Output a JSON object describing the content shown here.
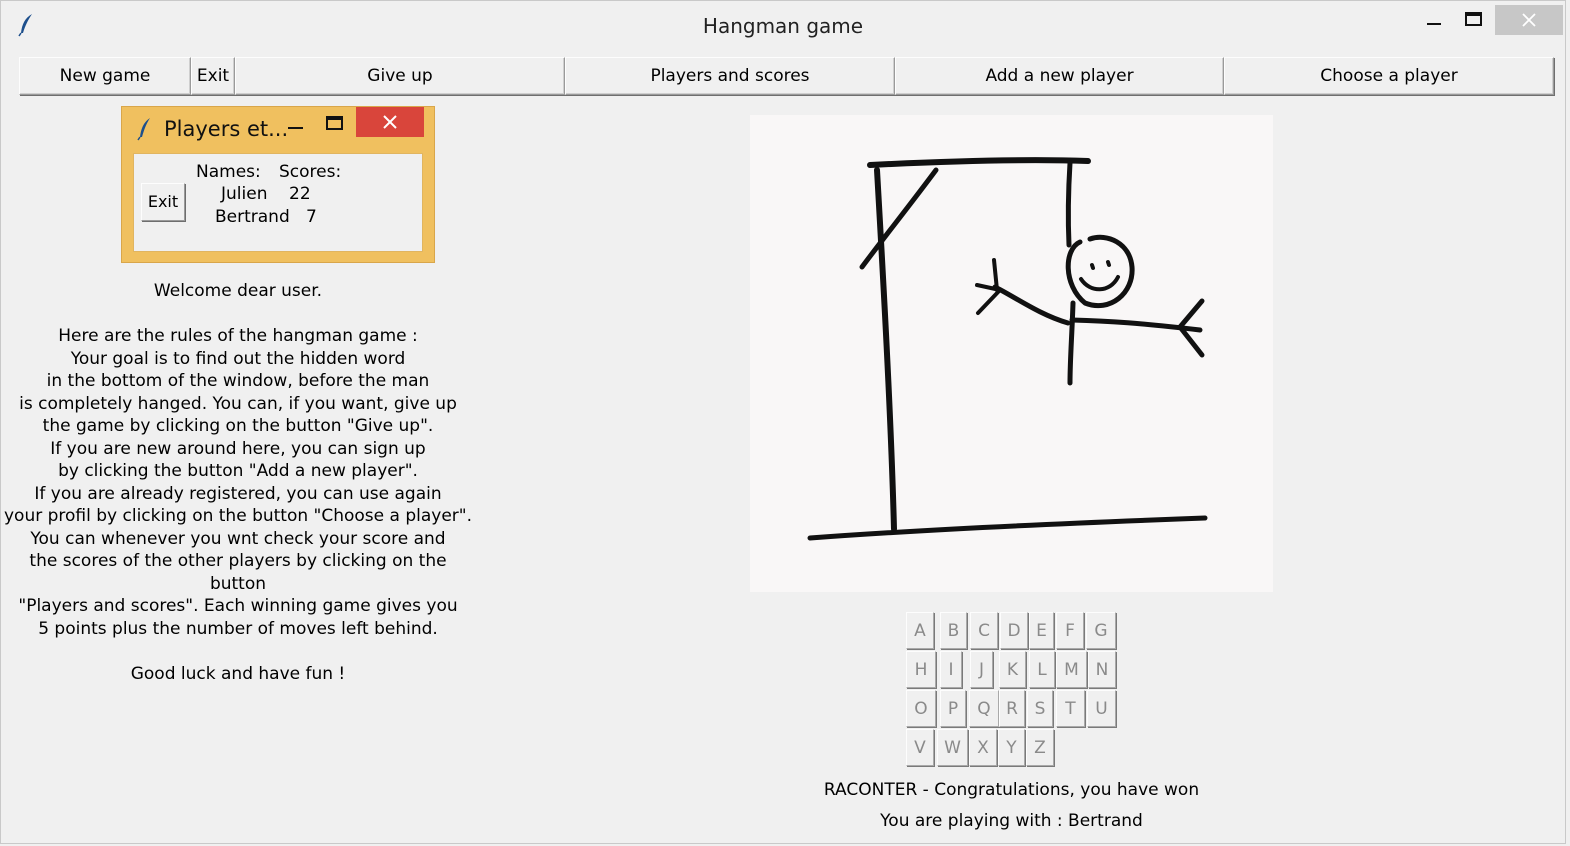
{
  "window": {
    "title": "Hangman game"
  },
  "toolbar": {
    "new_game": "New game",
    "exit": "Exit",
    "give_up": "Give up",
    "players_scores": "Players and scores",
    "add_player": "Add a new player",
    "choose_player": "Choose a player"
  },
  "popup": {
    "title": "Players et...",
    "exit": "Exit",
    "names_header": "Names:",
    "scores_header": "Scores:",
    "players": [
      {
        "name": "Julien",
        "score": "22"
      },
      {
        "name": "Bertrand",
        "score": "7"
      }
    ]
  },
  "rules": "Welcome dear user.\n\nHere are the rules of the hangman game :\nYour goal is to find out the hidden word\nin the bottom of the window, before the man\nis completely hanged. You can, if you want, give up\nthe game by clicking on the button \"Give up\".\nIf you are new around here, you can sign up\nby clicking the button \"Add a new player\".\nIf you are already registered, you can use again\nyour profil by clicking on the button \"Choose a player\".\nYou can whenever you wnt check your score and\nthe scores of the other players by clicking on the button\n\"Players and scores\". Each winning game gives you\n5 points plus the number of moves left behind.\n\nGood luck and have fun !",
  "keyboard": {
    "rows": [
      [
        "A",
        "B",
        "C",
        "D",
        "E",
        "F",
        "G"
      ],
      [
        "H",
        "I",
        "J",
        "K",
        "L",
        "M",
        "N"
      ],
      [
        "O",
        "P",
        "Q",
        "R",
        "S",
        "T",
        "U"
      ],
      [
        "V",
        "W",
        "X",
        "Y",
        "Z"
      ]
    ]
  },
  "status": {
    "result": "RACONTER - Congratulations, you have won",
    "player": "You are playing with : Bertrand"
  },
  "colors": {
    "window_bg": "#f0f0f0",
    "popup_frame": "#f0c05f",
    "popup_close": "#d9453b",
    "canvas_bg": "#f9f7f7",
    "disabled_key_text": "#8a8a8a"
  }
}
